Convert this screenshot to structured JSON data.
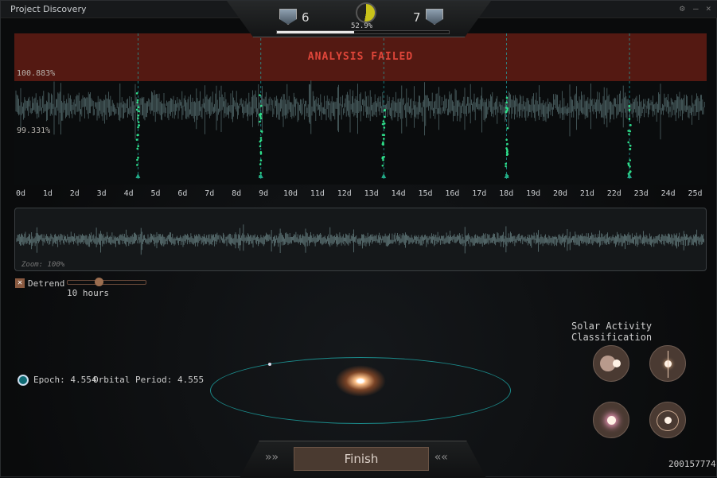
{
  "window": {
    "title": "Project Discovery",
    "controls": [
      "⚙",
      "–",
      "×"
    ]
  },
  "hud": {
    "left_count": "6",
    "right_count": "7",
    "accuracy_label": "52.9%",
    "accuracy": 0.529,
    "progress": 0.45
  },
  "chart_data": {
    "type": "scatter",
    "title": "ANALYSIS FAILED",
    "y_upper_label": "100.883%",
    "y_lower_label": "99.331%",
    "xlabel": "",
    "ylabel": "",
    "x_ticks": [
      "0d",
      "1d",
      "2d",
      "3d",
      "4d",
      "5d",
      "6d",
      "7d",
      "8d",
      "9d",
      "10d",
      "11d",
      "12d",
      "13d",
      "14d",
      "15d",
      "16d",
      "17d",
      "18d",
      "19d",
      "20d",
      "21d",
      "22d",
      "23d",
      "24d",
      "25d"
    ],
    "xlim": [
      0,
      25.5
    ],
    "transit_markers": [
      4.554,
      9.109,
      13.664,
      18.219,
      22.774
    ],
    "status_color": "#e0463a"
  },
  "mini": {
    "zoom_label": "Zoom: 100%"
  },
  "detrend": {
    "label": "Detrend",
    "checked": true,
    "value_label": "10 hours",
    "value_fraction": 0.4
  },
  "orbit": {
    "epoch_label": "Epoch: 4.554",
    "period_label": "Orbital Period: 4.555",
    "color": "#1b8a8a"
  },
  "classification": {
    "title": "Solar Activity Classification",
    "options": [
      "binary",
      "flare",
      "pulsating",
      "magnetic"
    ]
  },
  "finish_label": "Finish",
  "task_id": "200157774"
}
